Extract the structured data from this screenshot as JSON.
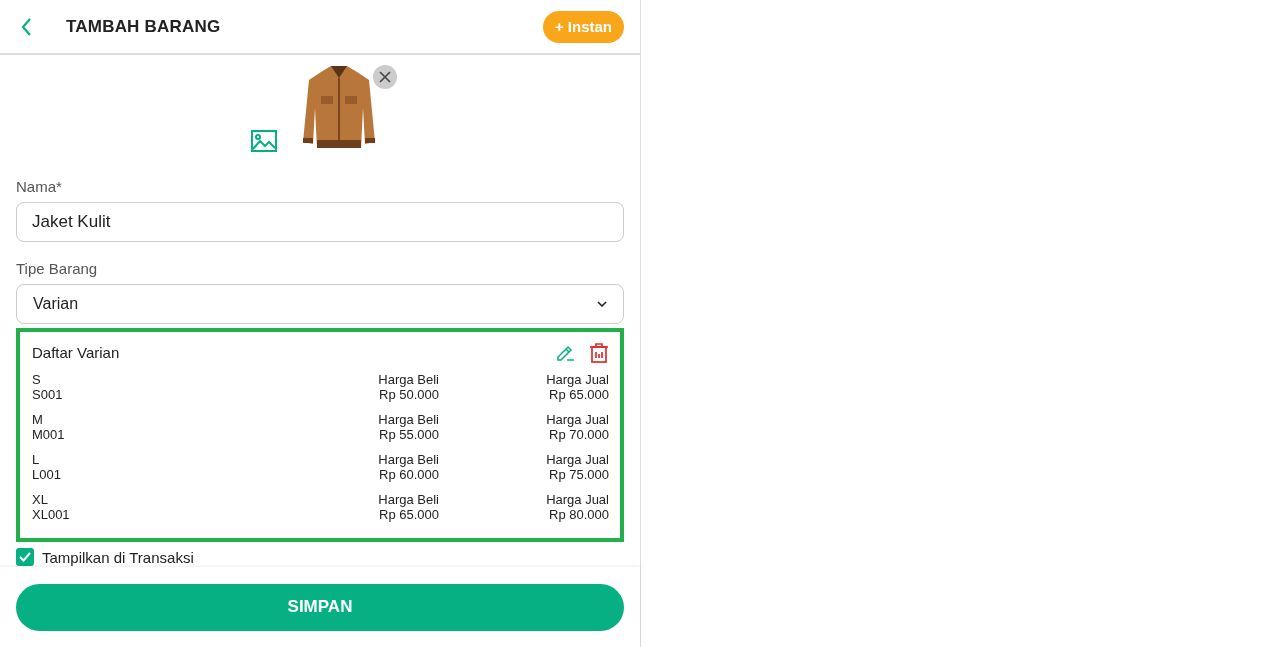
{
  "header": {
    "title": "TAMBAH BARANG",
    "instant_button": "+ Instan"
  },
  "name_field": {
    "label": "Nama*",
    "value": "Jaket Kulit"
  },
  "type_field": {
    "label": "Tipe Barang",
    "value": "Varian"
  },
  "variants": {
    "title": "Daftar Varian",
    "rows": [
      {
        "name": "S",
        "code": "S001",
        "buy_label": "Harga Beli",
        "buy_price": "Rp 50.000",
        "sell_label": "Harga Jual",
        "sell_price": "Rp 65.000"
      },
      {
        "name": "M",
        "code": "M001",
        "buy_label": "Harga Beli",
        "buy_price": "Rp 55.000",
        "sell_label": "Harga Jual",
        "sell_price": "Rp 70.000"
      },
      {
        "name": "L",
        "code": "L001",
        "buy_label": "Harga Beli",
        "buy_price": "Rp 60.000",
        "sell_label": "Harga Jual",
        "sell_price": "Rp 75.000"
      },
      {
        "name": "XL",
        "code": "XL001",
        "buy_label": "Harga Beli",
        "buy_price": "Rp 65.000",
        "sell_label": "Harga Jual",
        "sell_price": "Rp 80.000"
      }
    ]
  },
  "show_in_transactions": {
    "label": "Tampilkan di Transaksi",
    "checked": true
  },
  "save_button": "SIMPAN"
}
